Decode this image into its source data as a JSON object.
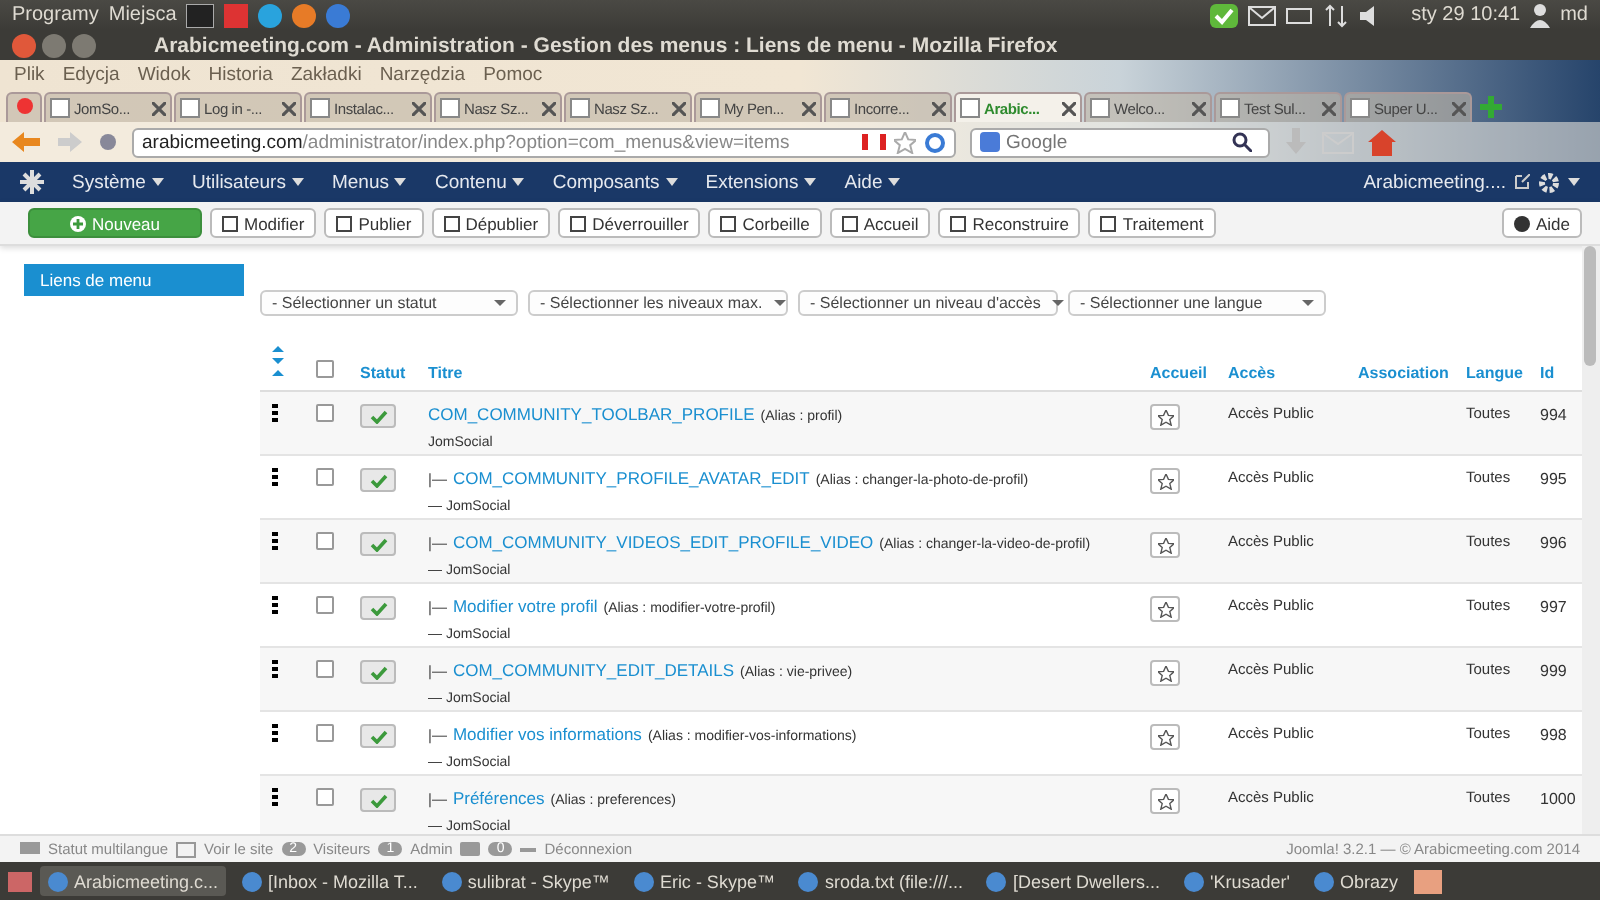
{
  "top_panel": {
    "menus": [
      "Programy",
      "Miejsca"
    ],
    "clock": "sty 29 10:41",
    "user": "md"
  },
  "window": {
    "title": "Arabicmeeting.com - Administration - Gestion des menus : Liens de menu - Mozilla Firefox"
  },
  "browser_menu": [
    "Plik",
    "Edycja",
    "Widok",
    "Historia",
    "Zakładki",
    "Narzędzia",
    "Pomoc"
  ],
  "tabs": [
    {
      "label": "JomSo...",
      "selected": false
    },
    {
      "label": "Log in -...",
      "selected": false
    },
    {
      "label": "Instalac...",
      "selected": false
    },
    {
      "label": "Nasz Sz...",
      "selected": false
    },
    {
      "label": "Nasz Sz...",
      "selected": false
    },
    {
      "label": "My Pen...",
      "selected": false
    },
    {
      "label": "Incorre...",
      "selected": false
    },
    {
      "label": "Arabic...",
      "selected": true
    },
    {
      "label": "Welco...",
      "selected": false
    },
    {
      "label": "Test Sul...",
      "selected": false
    },
    {
      "label": "Super U...",
      "selected": false
    }
  ],
  "address": {
    "host": "arabicmeeting.com",
    "path": "/administrator/index.php?option=com_menus&view=items"
  },
  "search": {
    "placeholder": "Google"
  },
  "admin_menu": [
    "Système",
    "Utilisateurs",
    "Menus",
    "Contenu",
    "Composants",
    "Extensions",
    "Aide"
  ],
  "site_link": "Arabicmeeting....",
  "toolbar": [
    {
      "label": "Nouveau",
      "kind": "primary"
    },
    {
      "label": "Modifier",
      "kind": "default"
    },
    {
      "label": "Publier",
      "kind": "default"
    },
    {
      "label": "Dépublier",
      "kind": "default"
    },
    {
      "label": "Déverrouiller",
      "kind": "default"
    },
    {
      "label": "Corbeille",
      "kind": "default"
    },
    {
      "label": "Accueil",
      "kind": "default"
    },
    {
      "label": "Reconstruire",
      "kind": "default"
    },
    {
      "label": "Traitement",
      "kind": "default"
    }
  ],
  "help_button": "Aide",
  "sidebar": {
    "items": [
      {
        "label": "Liens de menu",
        "selected": true
      }
    ]
  },
  "filters": [
    "- Sélectionner un statut",
    "- Sélectionner les niveaux max.",
    "- Sélectionner un niveau d'accès",
    "- Sélectionner une langue"
  ],
  "table": {
    "select_all_checked": false,
    "columns": [
      "Statut",
      "Titre",
      "Accueil",
      "Accès",
      "Association",
      "Langue",
      "Id"
    ],
    "rows": [
      {
        "prefix": "",
        "title": "COM_COMMUNITY_TOOLBAR_PROFILE",
        "alias": "(Alias : profil)",
        "menu": "JomSocial",
        "published": true,
        "checked": false,
        "home": false,
        "access": "Accès Public",
        "language": "Toutes",
        "id": "994"
      },
      {
        "prefix": "|—",
        "title": "COM_COMMUNITY_PROFILE_AVATAR_EDIT",
        "alias": "(Alias : changer-la-photo-de-profil)",
        "menu": "— JomSocial",
        "published": true,
        "checked": false,
        "home": false,
        "access": "Accès Public",
        "language": "Toutes",
        "id": "995"
      },
      {
        "prefix": "|—",
        "title": "COM_COMMUNITY_VIDEOS_EDIT_PROFILE_VIDEO",
        "alias": "(Alias : changer-la-video-de-profil)",
        "menu": "— JomSocial",
        "published": true,
        "checked": false,
        "home": false,
        "access": "Accès Public",
        "language": "Toutes",
        "id": "996"
      },
      {
        "prefix": "|—",
        "title": "Modifier votre profil",
        "alias": "(Alias : modifier-votre-profil)",
        "menu": "— JomSocial",
        "published": true,
        "checked": false,
        "home": false,
        "access": "Accès Public",
        "language": "Toutes",
        "id": "997"
      },
      {
        "prefix": "|—",
        "title": "COM_COMMUNITY_EDIT_DETAILS",
        "alias": "(Alias : vie-privee)",
        "menu": "— JomSocial",
        "published": true,
        "checked": false,
        "home": false,
        "access": "Accès Public",
        "language": "Toutes",
        "id": "999"
      },
      {
        "prefix": "|—",
        "title": "Modifier vos informations",
        "alias": "(Alias : modifier-vos-informations)",
        "menu": "— JomSocial",
        "published": true,
        "checked": false,
        "home": false,
        "access": "Accès Public",
        "language": "Toutes",
        "id": "998"
      },
      {
        "prefix": "|—",
        "title": "Préférences",
        "alias": "(Alias : preferences)",
        "menu": "— JomSocial",
        "published": true,
        "checked": false,
        "home": false,
        "access": "Accès Public",
        "language": "Toutes",
        "id": "1000"
      }
    ]
  },
  "status_bar": {
    "multilang": "Statut multilangue",
    "view_site": "Voir le site",
    "visitors_count": "2",
    "visitors": "Visiteurs",
    "admin_count": "1",
    "admin": "Admin",
    "messages_count": "0",
    "logout": "Déconnexion",
    "copyright": "Joomla! 3.2.1 — © Arabicmeeting.com 2014"
  },
  "taskbar": [
    {
      "label": "Arabicmeeting.c...",
      "selected": true
    },
    {
      "label": "[Inbox - Mozilla T...",
      "selected": false
    },
    {
      "label": "sulibrat - Skype™",
      "selected": false
    },
    {
      "label": "Eric - Skype™",
      "selected": false
    },
    {
      "label": "sroda.txt (file:///...",
      "selected": false
    },
    {
      "label": "[Desert Dwellers...",
      "selected": false
    },
    {
      "label": "'Krusader'",
      "selected": false
    },
    {
      "label": "Obrazy",
      "selected": false
    }
  ]
}
